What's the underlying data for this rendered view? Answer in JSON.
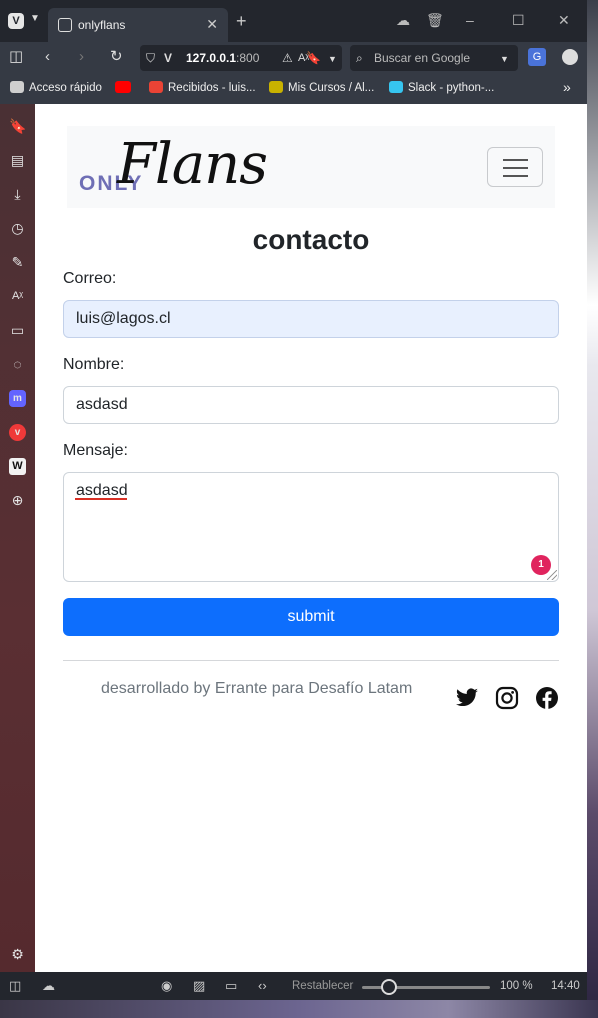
{
  "browser": {
    "tab_title": "onlyflans",
    "url_host": "127.0.0.1",
    "url_port": ":800",
    "search_placeholder": "Buscar en Google",
    "bookmarks": [
      {
        "label": "Acceso rápido",
        "color": "#cfcfcf"
      },
      {
        "label": "",
        "color": "#ff0000"
      },
      {
        "label": "Recibidos - luis...",
        "color": "#ea4335"
      },
      {
        "label": "Mis Cursos / Al...",
        "color": "#c9b200"
      },
      {
        "label": "Slack - python-...",
        "color": "#36c5f0"
      }
    ],
    "status": {
      "reset_label": "Restablecer",
      "zoom": "100 %",
      "time": "14:40"
    }
  },
  "navbar": {
    "brand_prefix": "ONLY",
    "brand_name": "Flans"
  },
  "form": {
    "title": "contacto",
    "email_label": "Correo:",
    "email_value": "luis@lagos.cl",
    "name_label": "Nombre:",
    "name_value": "asdasd",
    "message_label": "Mensaje:",
    "message_value": "asdasd",
    "error_count": "1",
    "submit_label": "submit"
  },
  "footer": {
    "text": "desarrollado by Errante para Desafío Latam",
    "social": [
      "twitter-icon",
      "instagram-icon",
      "facebook-icon"
    ]
  },
  "colors": {
    "primary": "#0d6efd",
    "brand_accent": "#6f6fb5",
    "autofill": "#e8f0fe",
    "error_badge": "#e0245e"
  }
}
